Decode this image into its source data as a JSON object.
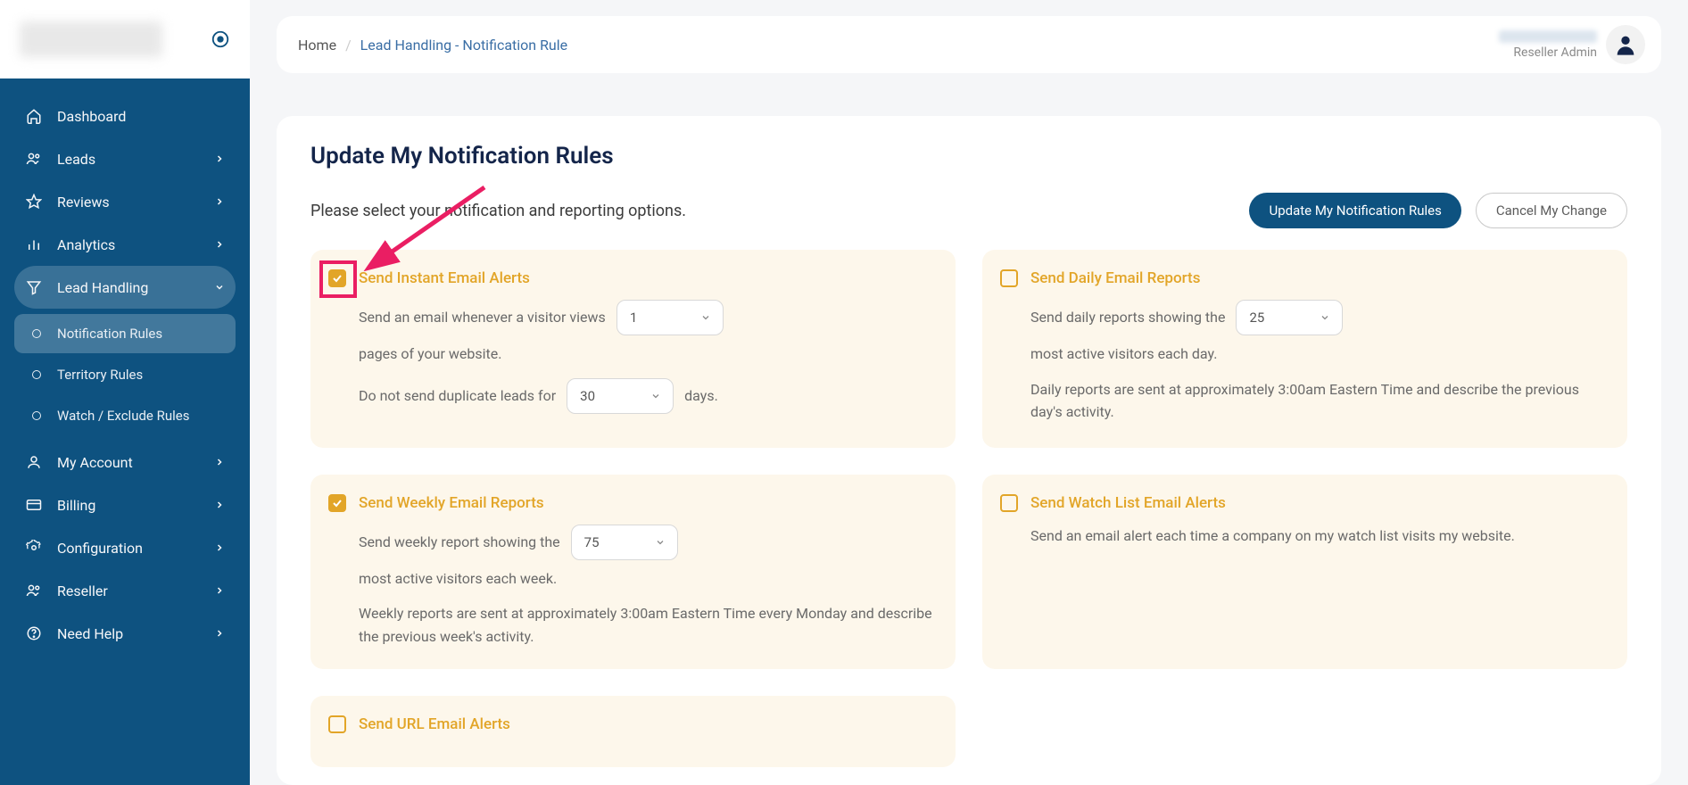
{
  "breadcrumb": {
    "home": "Home",
    "current": "Lead Handling - Notification Rule"
  },
  "user": {
    "role": "Reseller Admin"
  },
  "sidebar": {
    "items": [
      {
        "label": "Dashboard"
      },
      {
        "label": "Leads"
      },
      {
        "label": "Reviews"
      },
      {
        "label": "Analytics"
      },
      {
        "label": "Lead Handling"
      },
      {
        "label": "My Account"
      },
      {
        "label": "Billing"
      },
      {
        "label": "Configuration"
      },
      {
        "label": "Reseller"
      },
      {
        "label": "Need Help"
      }
    ],
    "subitems": [
      {
        "label": "Notification Rules"
      },
      {
        "label": "Territory Rules"
      },
      {
        "label": "Watch / Exclude Rules"
      }
    ]
  },
  "page": {
    "title": "Update My Notification Rules",
    "instruction": "Please select your notification and reporting options.",
    "buttons": {
      "update": "Update My Notification Rules",
      "cancel": "Cancel My Change"
    }
  },
  "cards": {
    "instant": {
      "title": "Send Instant Email Alerts",
      "line1a": "Send an email whenever a visitor views",
      "pages_value": "1",
      "line1b": "pages of your website.",
      "line2a": "Do not send duplicate leads for",
      "days_value": "30",
      "line2b": "days."
    },
    "daily": {
      "title": "Send Daily Email Reports",
      "line1a": "Send daily reports showing the",
      "count_value": "25",
      "line1b": "most active visitors each day.",
      "note": "Daily reports are sent at approximately 3:00am Eastern Time and describe the previous day's activity."
    },
    "weekly": {
      "title": "Send Weekly Email Reports",
      "line1a": "Send weekly report showing the",
      "count_value": "75",
      "line1b": "most active visitors each week.",
      "note": "Weekly reports are sent at approximately 3:00am Eastern Time every Monday and describe the previous week's activity."
    },
    "watch": {
      "title": "Send Watch List Email Alerts",
      "body": "Send an email alert each time a company on my watch list visits my website."
    },
    "url": {
      "title": "Send URL Email Alerts"
    }
  }
}
